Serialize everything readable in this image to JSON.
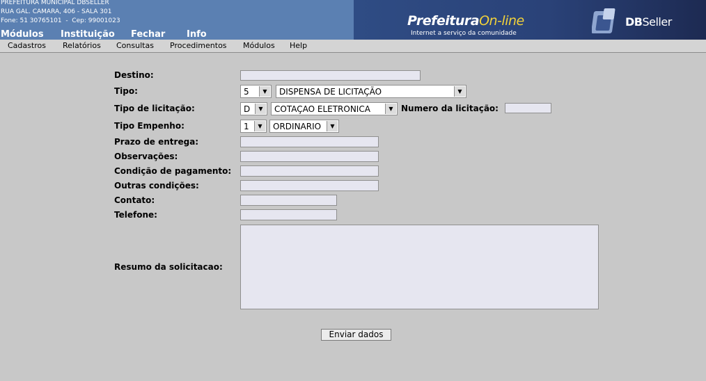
{
  "header": {
    "address_lines": [
      "PREFEITURA MUNICIPAL DBSELLER",
      "RUA GAL. CAMARA, 406 - SALA 301",
      "Fone: 51 30765101  -  Cep: 99001023"
    ],
    "top_menu": [
      "Módulos",
      "Instituição",
      "Fechar",
      "Info"
    ],
    "logo_prefeitura": "Prefeitura",
    "logo_online": "On-line",
    "logo_tagline": "Internet a serviço da comunidade",
    "logo_db": "DB",
    "logo_seller": "Seller"
  },
  "menu": [
    "Cadastros",
    "Relatórios",
    "Consultas",
    "Procedimentos",
    "Módulos",
    "Help"
  ],
  "form": {
    "destino_label": "Destino:",
    "tipo_label": "Tipo:",
    "tipo_code": "5",
    "tipo_value": "DISPENSA DE LICITAÇÃO",
    "tipo_licitacao_label": "Tipo de licitação:",
    "tipo_licitacao_code": "D",
    "tipo_licitacao_value": "COTAÇAO ELETRONICA",
    "numero_licitacao_label": "Numero da licitação:",
    "tipo_empenho_label": "Tipo Empenho:",
    "tipo_empenho_code": "1",
    "tipo_empenho_value": "ORDINARIO",
    "prazo_label": "Prazo de entrega:",
    "observacoes_label": "Observações:",
    "condicao_label": "Condição de pagamento:",
    "outras_label": "Outras condições:",
    "contato_label": "Contato:",
    "telefone_label": "Telefone:",
    "resumo_label": "Resumo da solicitacao:",
    "submit_label": "Enviar dados"
  },
  "colors": {
    "header_blue": "#5b80b2",
    "header_dark": "#2a4278",
    "accent_yellow": "#f2d23a",
    "background": "#c8c8c8"
  }
}
